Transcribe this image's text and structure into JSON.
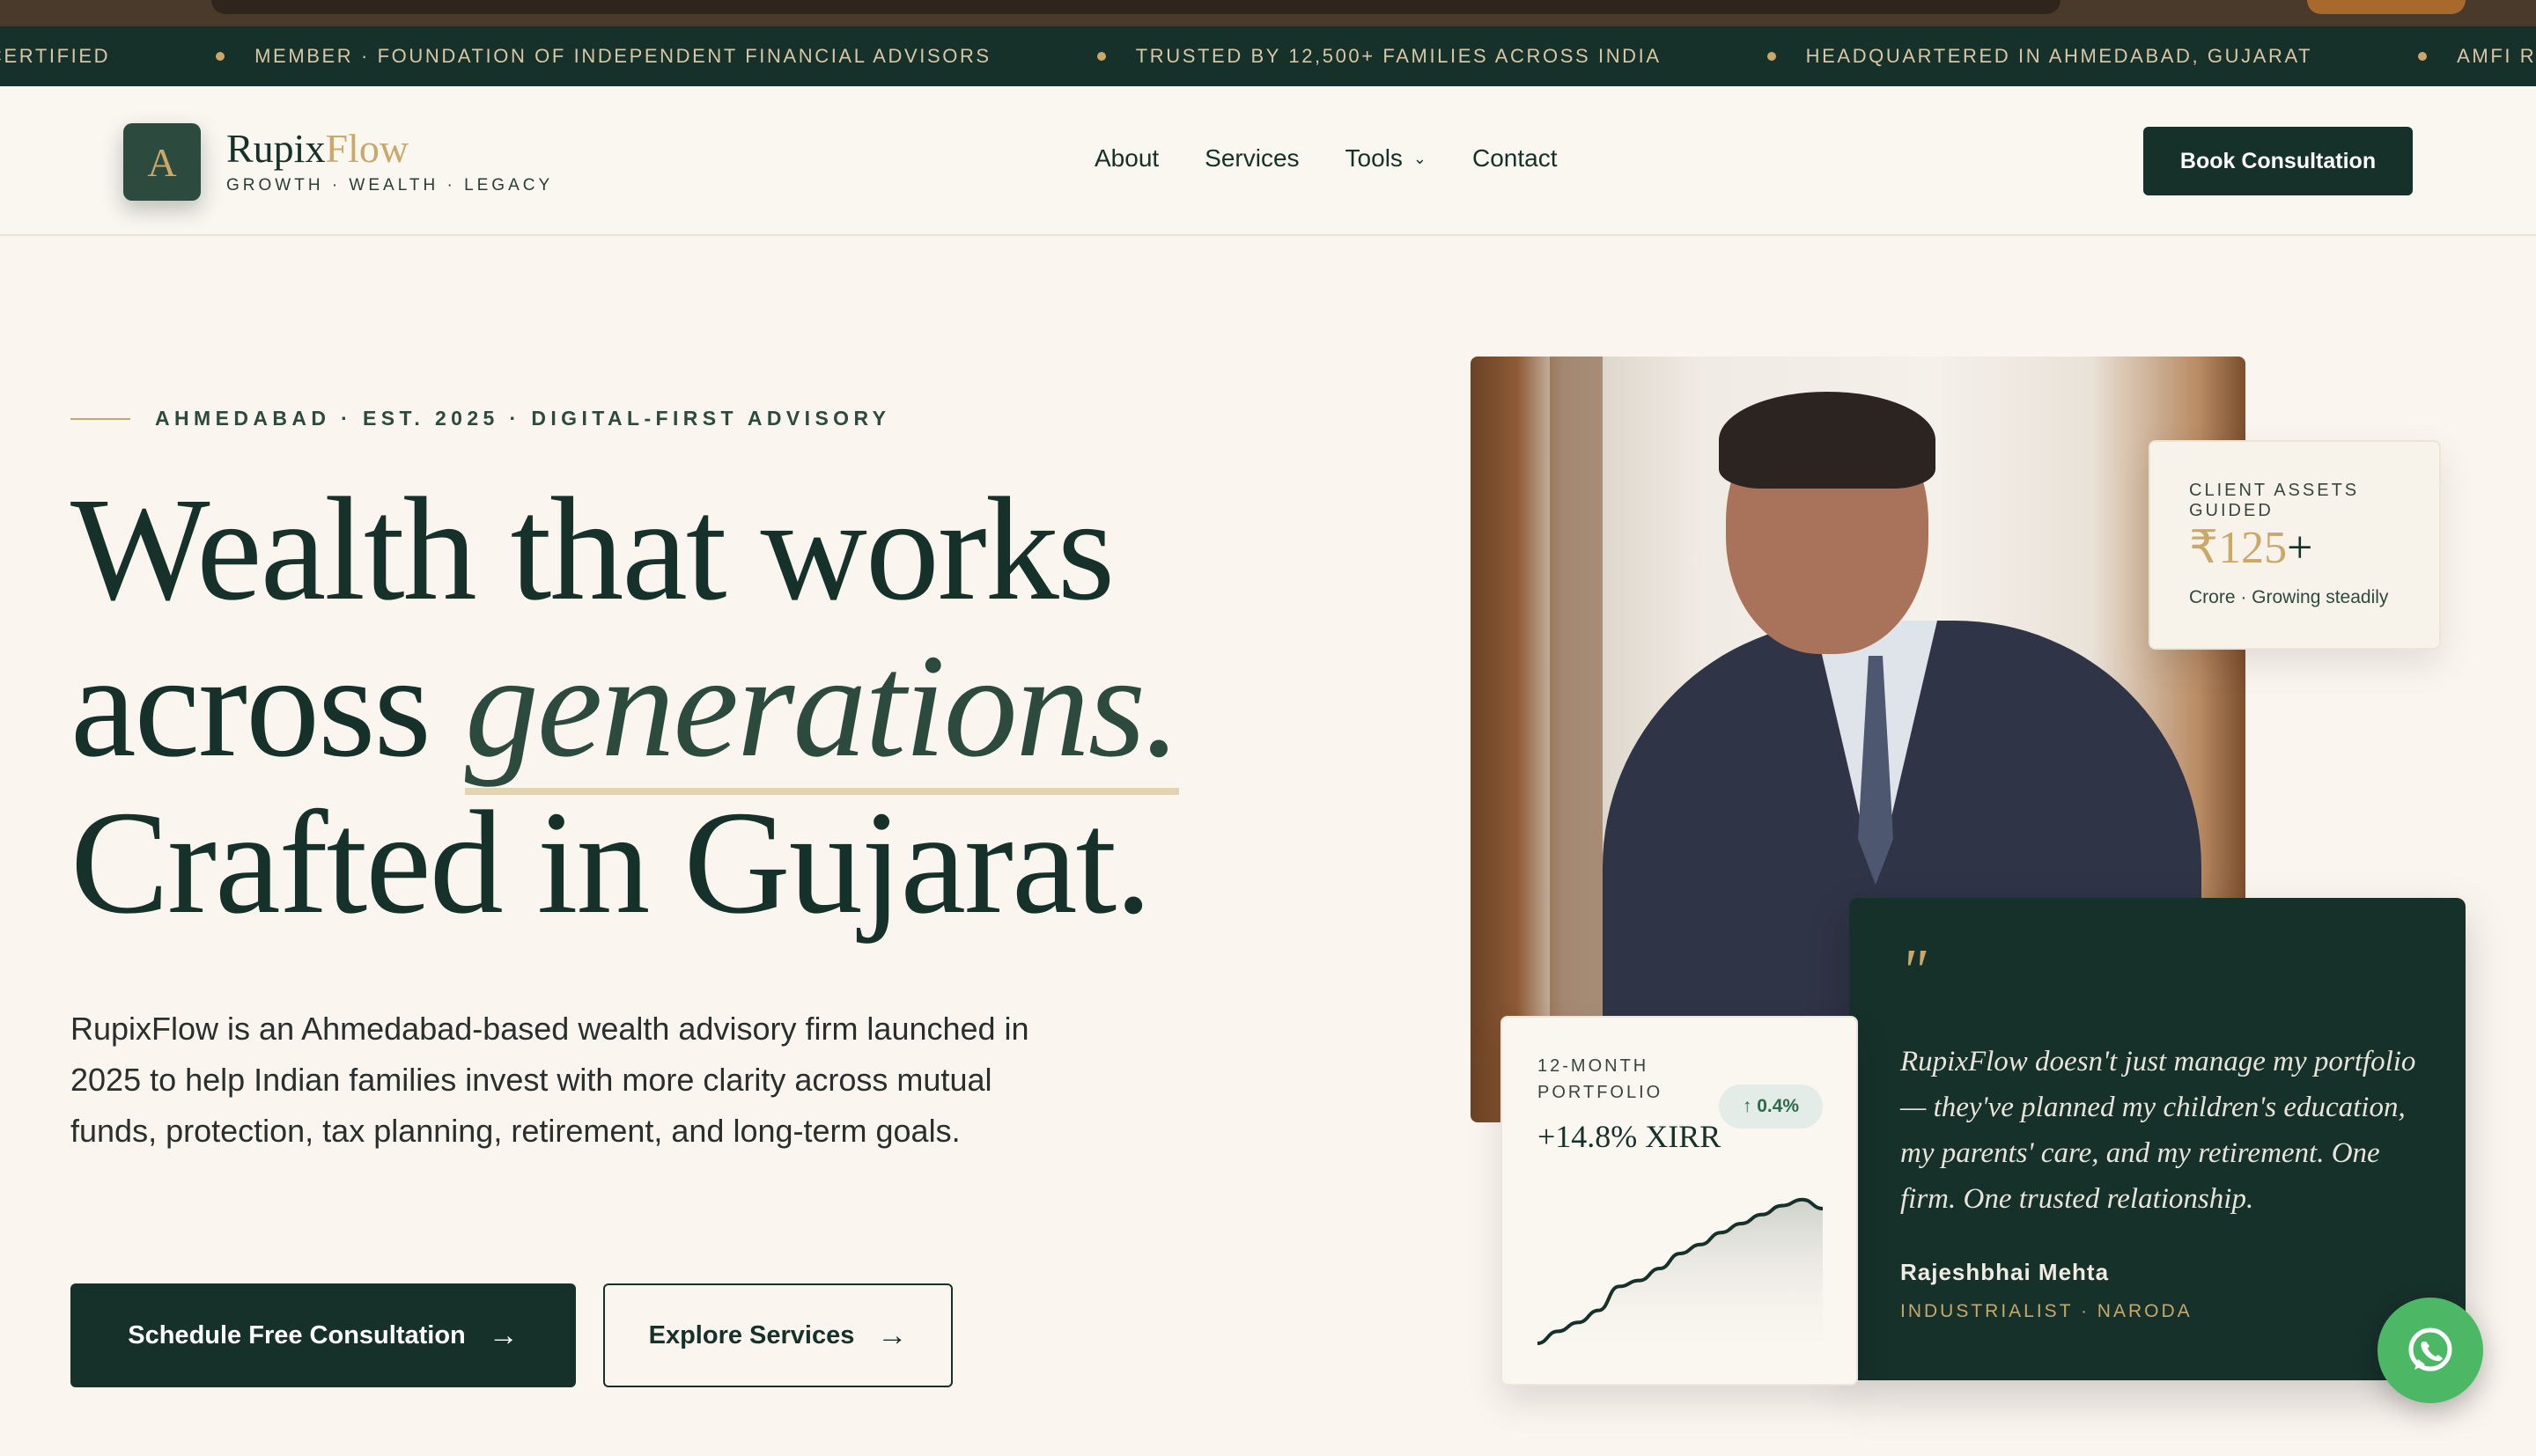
{
  "ticker": {
    "items": [
      "CERTIFIED",
      "MEMBER · FOUNDATION OF INDEPENDENT FINANCIAL ADVISORS",
      "TRUSTED BY 12,500+ FAMILIES ACROSS INDIA",
      "HEADQUARTERED IN AHMEDABAD, GUJARAT",
      "AMFI REGISTERED"
    ]
  },
  "brand": {
    "logo_letter": "A",
    "name_part1": "Rupix",
    "name_part2": "Flow",
    "tagline": "GROWTH · WEALTH · LEGACY",
    "colors": {
      "primary": "#16302a",
      "accent": "#c9a86a",
      "background": "#faf5ef",
      "whatsapp": "#4cb866"
    }
  },
  "nav": {
    "links": [
      "About",
      "Services",
      "Tools",
      "Contact"
    ],
    "book_label": "Book Consultation"
  },
  "hero": {
    "eyebrow": "AHMEDABAD · EST. 2025 · DIGITAL-FIRST ADVISORY",
    "title_line1": "Wealth that works",
    "title_line2_a": "across ",
    "title_line2_b": "generations.",
    "title_line3": "Crafted in Gujarat.",
    "lead": "RupixFlow is an Ahmedabad-based wealth advisory firm launched in 2025 to help Indian families invest with more clarity across mutual funds, protection, tax planning, retirement, and long-term goals.",
    "cta_primary": "Schedule Free Consultation",
    "cta_secondary": "Explore Services"
  },
  "assets_card": {
    "label": "CLIENT ASSETS GUIDED",
    "value": "₹125",
    "value_suffix": "+",
    "sub": "Crore · Growing steadily"
  },
  "performance_card": {
    "label": "12-MONTH PORTFOLIO",
    "badge": "↑ 0.4%",
    "value": "+14.8% XIRR",
    "trend": [
      0.0,
      0.08,
      0.14,
      0.22,
      0.38,
      0.42,
      0.5,
      0.6,
      0.66,
      0.74,
      0.8,
      0.86,
      0.92,
      0.96,
      0.9
    ]
  },
  "testimonial": {
    "quote_mark": "\"",
    "text": "RupixFlow doesn't just manage my portfolio — they've planned my children's education, my parents' care, and my retirement. One firm. One trusted relationship.",
    "name": "Rajeshbhai Mehta",
    "role": "INDUSTRIALIST · NARODA"
  },
  "icons": {
    "chevron": "chevron-down-icon",
    "arrow": "arrow-right-icon",
    "whatsapp": "whatsapp-icon"
  }
}
